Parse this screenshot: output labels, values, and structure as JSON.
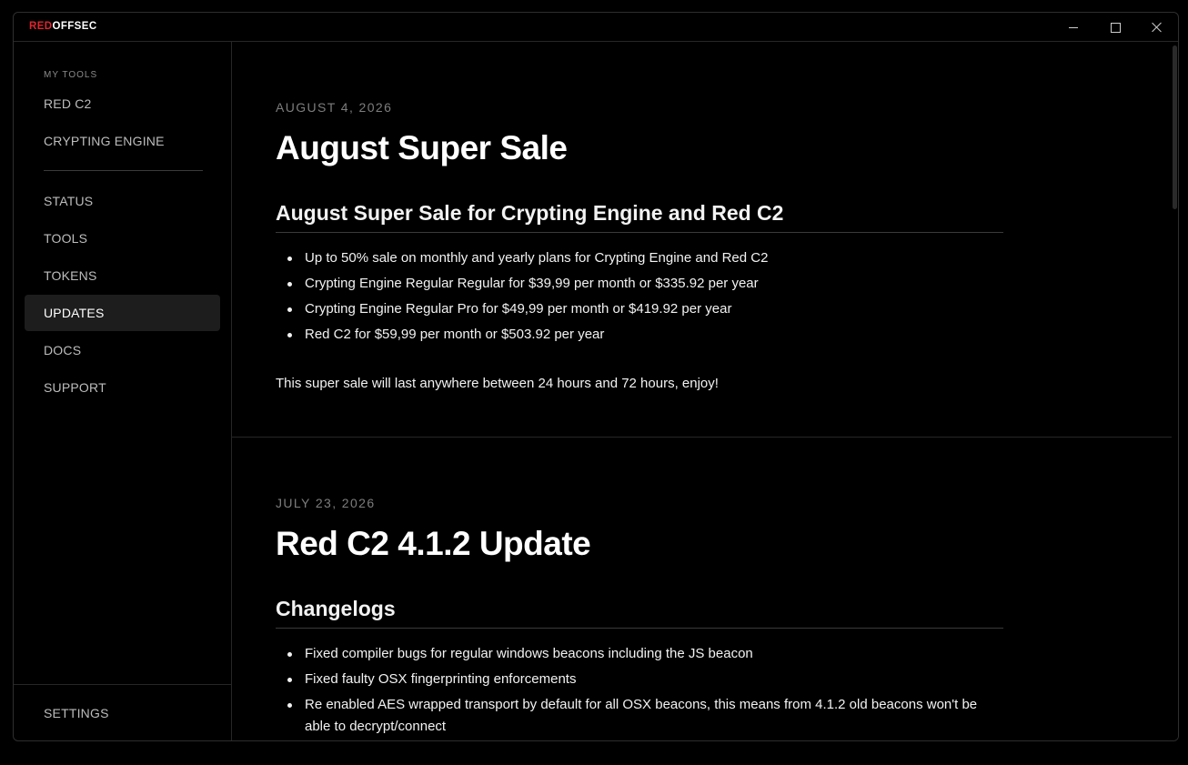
{
  "app": {
    "brand_red": "RED",
    "brand_white": "OFFSEC",
    "colors": {
      "accent": "#e0242f",
      "background": "#000000",
      "active_item": "#1d1d1d"
    }
  },
  "window_controls": {
    "minimize_icon": "minimize-icon",
    "maximize_icon": "maximize-icon",
    "close_icon": "close-icon"
  },
  "sidebar": {
    "section_label": "MY TOOLS",
    "tools": [
      {
        "label": "RED C2"
      },
      {
        "label": "CRYPTING ENGINE"
      }
    ],
    "nav": [
      {
        "label": "STATUS"
      },
      {
        "label": "TOOLS"
      },
      {
        "label": "TOKENS"
      },
      {
        "label": "UPDATES",
        "active": true
      },
      {
        "label": "DOCS"
      },
      {
        "label": "SUPPORT"
      }
    ],
    "settings_label": "SETTINGS"
  },
  "posts": [
    {
      "date": "AUGUST 4, 2026",
      "title": "August Super Sale",
      "subtitle": "August Super Sale for Crypting Engine and Red C2",
      "bullets": [
        "Up to 50% sale on monthly and yearly plans for Crypting Engine and Red C2",
        "Crypting Engine Regular Regular for $39,99 per month or $335.92 per year",
        "Crypting Engine Regular Pro for $49,99 per month or $419.92 per year",
        "Red C2 for $59,99 per month or $503.92 per year"
      ],
      "note": "This super sale will last anywhere between 24 hours and 72 hours, enjoy!"
    },
    {
      "date": "JULY 23, 2026",
      "title": "Red C2 4.1.2 Update",
      "subtitle": "Changelogs",
      "bullets": [
        "Fixed compiler bugs for regular windows beacons including the JS beacon",
        "Fixed faulty OSX fingerprinting enforcements",
        "Re enabled AES wrapped transport by default for all OSX beacons, this means from 4.1.2 old beacons won't be able to decrypt/connect"
      ]
    }
  ]
}
